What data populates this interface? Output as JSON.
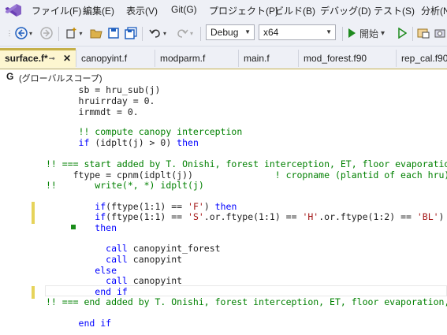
{
  "menu": [
    "ファイル(F)",
    "編集(E)",
    "表示(V)",
    "Git(G)",
    "プロジェクト(P)",
    "ビルド(B)",
    "デバッグ(D)",
    "テスト(S)",
    "分析(N"
  ],
  "toolbar": {
    "config": "Debug",
    "platform": "x64",
    "start_label": "開始",
    "start_dropdown": "▾"
  },
  "tabs": [
    {
      "label": "surface.f*",
      "active": true
    },
    {
      "label": "canopyint.f",
      "active": false
    },
    {
      "label": "modparm.f",
      "active": false
    },
    {
      "label": "main.f",
      "active": false
    },
    {
      "label": "mod_forest.f90",
      "active": false
    },
    {
      "label": "rep_cal.f90",
      "active": false
    }
  ],
  "navbar": {
    "icon": "G",
    "scope": "(グローバルスコープ)"
  },
  "code": {
    "l1": "      sb = hru_sub(j)",
    "l2": "      hruirrday = 0.",
    "l3": "      irmmdt = 0.",
    "l5_comment": "      !! compute canopy interception",
    "l6_if": "      if",
    "l6_mid": " (idplt(j) > 0) ",
    "l6_then": "then",
    "l8_comment": "!! === start added by T. Onishi, forest interception, ET, floor evaporation, F",
    "l9_code": "     ftype = cpnm(idplt(j))",
    "l9_comment": "               ! cropname (plantid of each hru)",
    "l10_comment": "!!       write(*, *) idplt(j)",
    "l12_if": "         if",
    "l12_a": "(ftype(1:1) == ",
    "l12_str": "'F'",
    "l12_b": ") ",
    "l12_then": "then",
    "l13_if": "         if",
    "l13_a": "(ftype(1:1) == ",
    "l13_s1": "'S'",
    "l13_b": ".or.ftype(1:1) == ",
    "l13_s2": "'H'",
    "l13_c": ".or.ftype(1:2) == ",
    "l13_s3": "'BL'",
    "l13_d": ")",
    "l14_then": "         then",
    "l16_call": "           call",
    "l16_rest": " canopyint_forest",
    "l17_call": "           call",
    "l17_rest": " canopyint",
    "l18_else": "         else",
    "l19_call": "           call",
    "l19_rest": " canopyint",
    "l20_endif": "         end if",
    "l21_comment": "!! === end added by T. Onishi, forest interception, ET, floor evaporation, F",
    "l23_endif": "      end if"
  }
}
